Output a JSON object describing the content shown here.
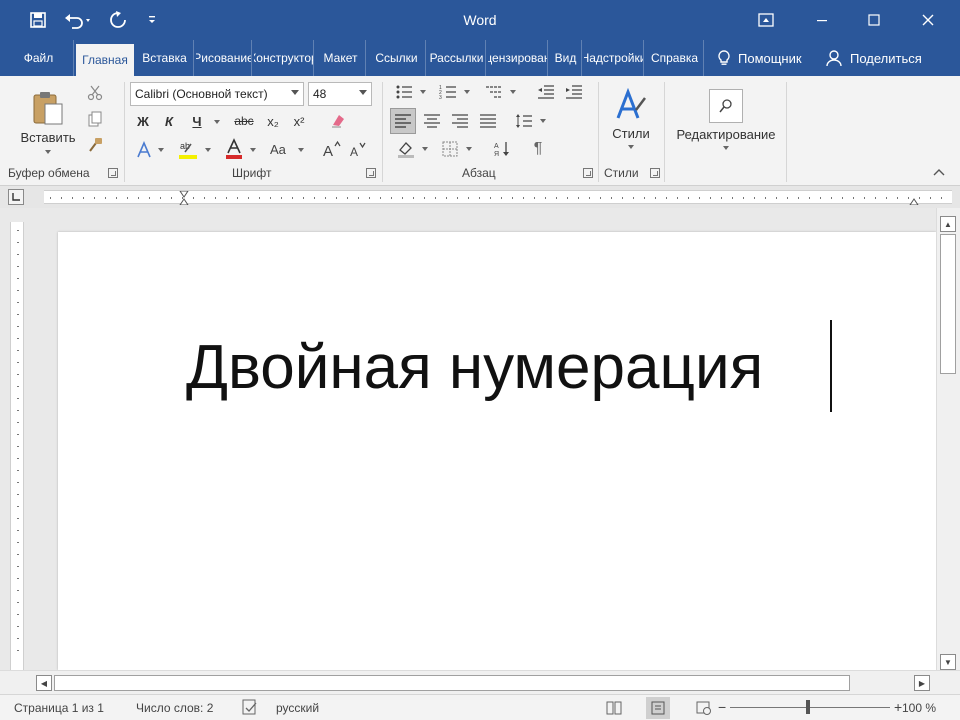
{
  "titlebar": {
    "app_title": "Word",
    "accent": "#2b579a"
  },
  "qat": {
    "icons": [
      "save-icon",
      "undo-icon",
      "redo-icon",
      "customize-icon"
    ]
  },
  "tabs": {
    "items": [
      "Файл",
      "Главная",
      "Вставка",
      "Рисование",
      "Конструктор",
      "Макет",
      "Ссылки",
      "Рассылки",
      "Рецензирование",
      "Вид",
      "Надстройки",
      "Справка"
    ],
    "active_index": 1,
    "help_label": "Помощник",
    "share_label": "Поделиться"
  },
  "ribbon": {
    "clipboard": {
      "paste_label": "Вставить",
      "group_label": "Буфер обмена"
    },
    "font": {
      "font_name": "Calibri (Основной текст)",
      "font_size": "48",
      "bold": "Ж",
      "italic": "К",
      "underline": "Ч",
      "strike": "abc",
      "subscript": "x₂",
      "superscript": "x²",
      "group_label": "Шрифт"
    },
    "paragraph": {
      "group_label": "Абзац"
    },
    "styles": {
      "label": "Стили",
      "group_label": "Стили"
    },
    "editing": {
      "label": "Редактирование"
    }
  },
  "document": {
    "text": "Двойная нумерация"
  },
  "statusbar": {
    "page": "Страница 1 из 1",
    "words": "Число слов: 2",
    "language": "русский",
    "zoom": "100 %"
  }
}
